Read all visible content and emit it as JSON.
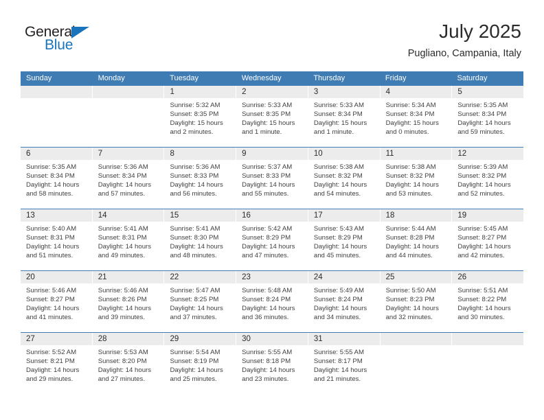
{
  "brand": {
    "word_one": "General",
    "word_two": "Blue",
    "triangle_icon": "triangle-icon",
    "accent_color": "#1a74bb"
  },
  "header": {
    "title": "July 2025",
    "subtitle": "Pugliano, Campania, Italy"
  },
  "theme": {
    "header_blue": "#3f7cb4",
    "daynum_band": "#ececec",
    "text": "#404040"
  },
  "weekdays": [
    "Sunday",
    "Monday",
    "Tuesday",
    "Wednesday",
    "Thursday",
    "Friday",
    "Saturday"
  ],
  "weeks": [
    [
      {
        "day": "",
        "sunrise": "",
        "sunset": "",
        "daylight_1": "",
        "daylight_2": ""
      },
      {
        "day": "",
        "sunrise": "",
        "sunset": "",
        "daylight_1": "",
        "daylight_2": ""
      },
      {
        "day": "1",
        "sunrise": "Sunrise: 5:32 AM",
        "sunset": "Sunset: 8:35 PM",
        "daylight_1": "Daylight: 15 hours",
        "daylight_2": "and 2 minutes."
      },
      {
        "day": "2",
        "sunrise": "Sunrise: 5:33 AM",
        "sunset": "Sunset: 8:35 PM",
        "daylight_1": "Daylight: 15 hours",
        "daylight_2": "and 1 minute."
      },
      {
        "day": "3",
        "sunrise": "Sunrise: 5:33 AM",
        "sunset": "Sunset: 8:34 PM",
        "daylight_1": "Daylight: 15 hours",
        "daylight_2": "and 1 minute."
      },
      {
        "day": "4",
        "sunrise": "Sunrise: 5:34 AM",
        "sunset": "Sunset: 8:34 PM",
        "daylight_1": "Daylight: 15 hours",
        "daylight_2": "and 0 minutes."
      },
      {
        "day": "5",
        "sunrise": "Sunrise: 5:35 AM",
        "sunset": "Sunset: 8:34 PM",
        "daylight_1": "Daylight: 14 hours",
        "daylight_2": "and 59 minutes."
      }
    ],
    [
      {
        "day": "6",
        "sunrise": "Sunrise: 5:35 AM",
        "sunset": "Sunset: 8:34 PM",
        "daylight_1": "Daylight: 14 hours",
        "daylight_2": "and 58 minutes."
      },
      {
        "day": "7",
        "sunrise": "Sunrise: 5:36 AM",
        "sunset": "Sunset: 8:34 PM",
        "daylight_1": "Daylight: 14 hours",
        "daylight_2": "and 57 minutes."
      },
      {
        "day": "8",
        "sunrise": "Sunrise: 5:36 AM",
        "sunset": "Sunset: 8:33 PM",
        "daylight_1": "Daylight: 14 hours",
        "daylight_2": "and 56 minutes."
      },
      {
        "day": "9",
        "sunrise": "Sunrise: 5:37 AM",
        "sunset": "Sunset: 8:33 PM",
        "daylight_1": "Daylight: 14 hours",
        "daylight_2": "and 55 minutes."
      },
      {
        "day": "10",
        "sunrise": "Sunrise: 5:38 AM",
        "sunset": "Sunset: 8:32 PM",
        "daylight_1": "Daylight: 14 hours",
        "daylight_2": "and 54 minutes."
      },
      {
        "day": "11",
        "sunrise": "Sunrise: 5:38 AM",
        "sunset": "Sunset: 8:32 PM",
        "daylight_1": "Daylight: 14 hours",
        "daylight_2": "and 53 minutes."
      },
      {
        "day": "12",
        "sunrise": "Sunrise: 5:39 AM",
        "sunset": "Sunset: 8:32 PM",
        "daylight_1": "Daylight: 14 hours",
        "daylight_2": "and 52 minutes."
      }
    ],
    [
      {
        "day": "13",
        "sunrise": "Sunrise: 5:40 AM",
        "sunset": "Sunset: 8:31 PM",
        "daylight_1": "Daylight: 14 hours",
        "daylight_2": "and 51 minutes."
      },
      {
        "day": "14",
        "sunrise": "Sunrise: 5:41 AM",
        "sunset": "Sunset: 8:31 PM",
        "daylight_1": "Daylight: 14 hours",
        "daylight_2": "and 49 minutes."
      },
      {
        "day": "15",
        "sunrise": "Sunrise: 5:41 AM",
        "sunset": "Sunset: 8:30 PM",
        "daylight_1": "Daylight: 14 hours",
        "daylight_2": "and 48 minutes."
      },
      {
        "day": "16",
        "sunrise": "Sunrise: 5:42 AM",
        "sunset": "Sunset: 8:29 PM",
        "daylight_1": "Daylight: 14 hours",
        "daylight_2": "and 47 minutes."
      },
      {
        "day": "17",
        "sunrise": "Sunrise: 5:43 AM",
        "sunset": "Sunset: 8:29 PM",
        "daylight_1": "Daylight: 14 hours",
        "daylight_2": "and 45 minutes."
      },
      {
        "day": "18",
        "sunrise": "Sunrise: 5:44 AM",
        "sunset": "Sunset: 8:28 PM",
        "daylight_1": "Daylight: 14 hours",
        "daylight_2": "and 44 minutes."
      },
      {
        "day": "19",
        "sunrise": "Sunrise: 5:45 AM",
        "sunset": "Sunset: 8:27 PM",
        "daylight_1": "Daylight: 14 hours",
        "daylight_2": "and 42 minutes."
      }
    ],
    [
      {
        "day": "20",
        "sunrise": "Sunrise: 5:46 AM",
        "sunset": "Sunset: 8:27 PM",
        "daylight_1": "Daylight: 14 hours",
        "daylight_2": "and 41 minutes."
      },
      {
        "day": "21",
        "sunrise": "Sunrise: 5:46 AM",
        "sunset": "Sunset: 8:26 PM",
        "daylight_1": "Daylight: 14 hours",
        "daylight_2": "and 39 minutes."
      },
      {
        "day": "22",
        "sunrise": "Sunrise: 5:47 AM",
        "sunset": "Sunset: 8:25 PM",
        "daylight_1": "Daylight: 14 hours",
        "daylight_2": "and 37 minutes."
      },
      {
        "day": "23",
        "sunrise": "Sunrise: 5:48 AM",
        "sunset": "Sunset: 8:24 PM",
        "daylight_1": "Daylight: 14 hours",
        "daylight_2": "and 36 minutes."
      },
      {
        "day": "24",
        "sunrise": "Sunrise: 5:49 AM",
        "sunset": "Sunset: 8:24 PM",
        "daylight_1": "Daylight: 14 hours",
        "daylight_2": "and 34 minutes."
      },
      {
        "day": "25",
        "sunrise": "Sunrise: 5:50 AM",
        "sunset": "Sunset: 8:23 PM",
        "daylight_1": "Daylight: 14 hours",
        "daylight_2": "and 32 minutes."
      },
      {
        "day": "26",
        "sunrise": "Sunrise: 5:51 AM",
        "sunset": "Sunset: 8:22 PM",
        "daylight_1": "Daylight: 14 hours",
        "daylight_2": "and 30 minutes."
      }
    ],
    [
      {
        "day": "27",
        "sunrise": "Sunrise: 5:52 AM",
        "sunset": "Sunset: 8:21 PM",
        "daylight_1": "Daylight: 14 hours",
        "daylight_2": "and 29 minutes."
      },
      {
        "day": "28",
        "sunrise": "Sunrise: 5:53 AM",
        "sunset": "Sunset: 8:20 PM",
        "daylight_1": "Daylight: 14 hours",
        "daylight_2": "and 27 minutes."
      },
      {
        "day": "29",
        "sunrise": "Sunrise: 5:54 AM",
        "sunset": "Sunset: 8:19 PM",
        "daylight_1": "Daylight: 14 hours",
        "daylight_2": "and 25 minutes."
      },
      {
        "day": "30",
        "sunrise": "Sunrise: 5:55 AM",
        "sunset": "Sunset: 8:18 PM",
        "daylight_1": "Daylight: 14 hours",
        "daylight_2": "and 23 minutes."
      },
      {
        "day": "31",
        "sunrise": "Sunrise: 5:55 AM",
        "sunset": "Sunset: 8:17 PM",
        "daylight_1": "Daylight: 14 hours",
        "daylight_2": "and 21 minutes."
      },
      {
        "day": "",
        "sunrise": "",
        "sunset": "",
        "daylight_1": "",
        "daylight_2": ""
      },
      {
        "day": "",
        "sunrise": "",
        "sunset": "",
        "daylight_1": "",
        "daylight_2": ""
      }
    ]
  ]
}
